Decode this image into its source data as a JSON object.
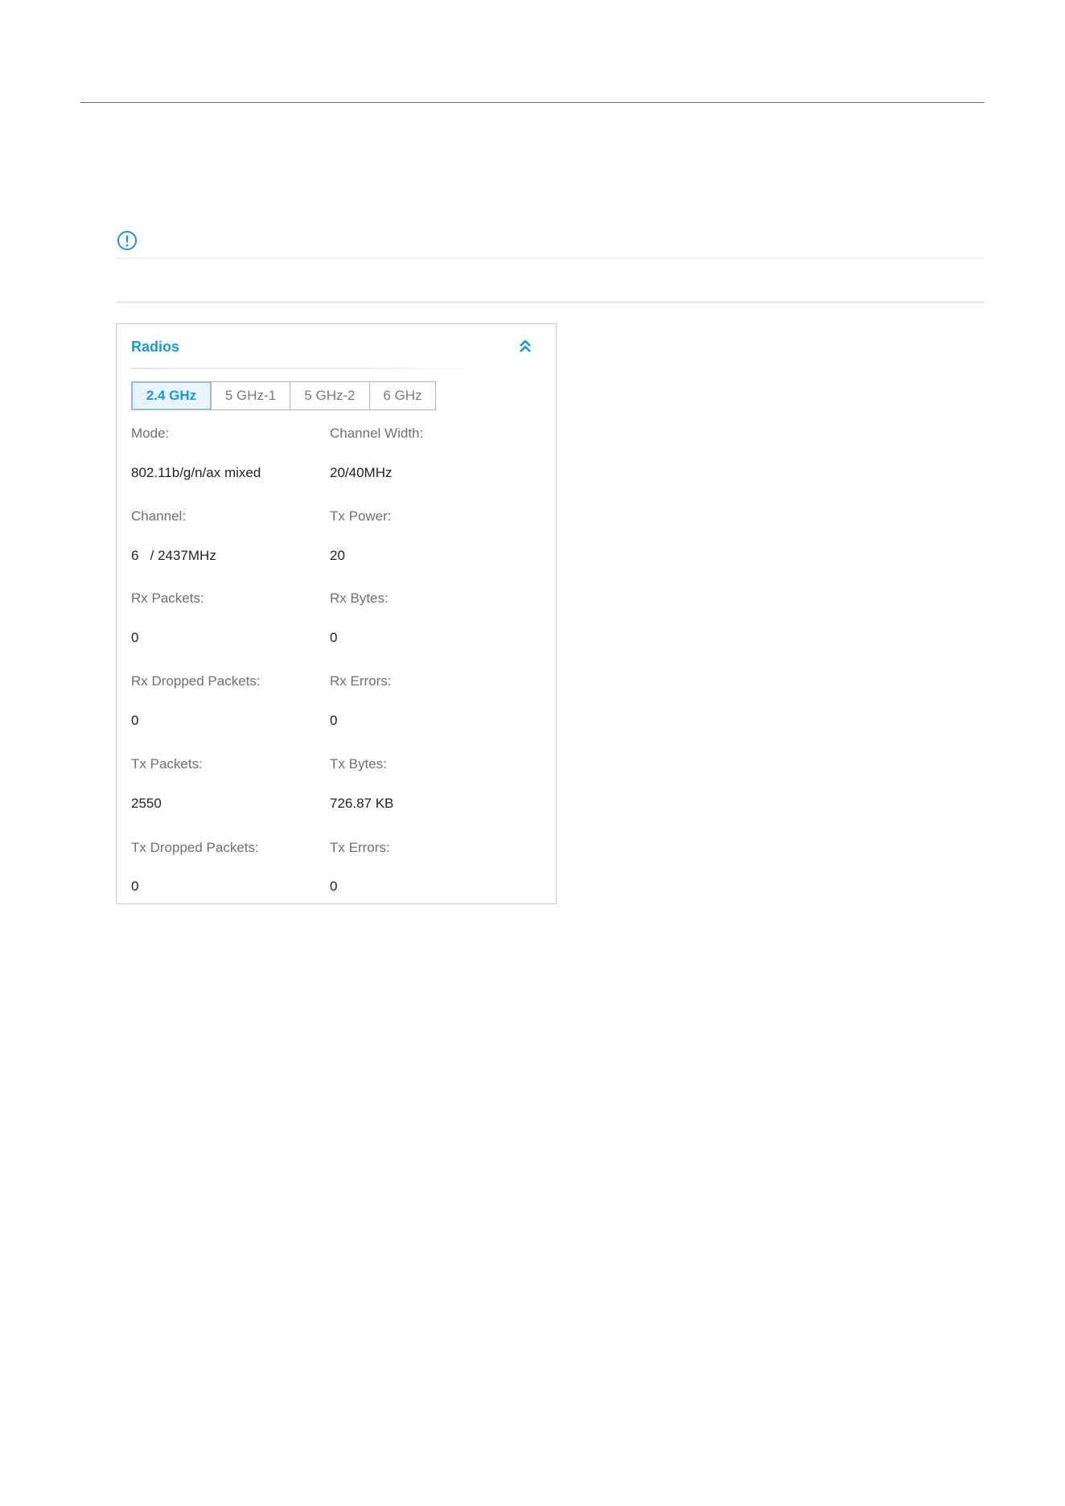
{
  "card": {
    "title": "Radios",
    "tabs": [
      {
        "label": "2.4 GHz",
        "active": true
      },
      {
        "label": "5 GHz-1",
        "active": false
      },
      {
        "label": "5 GHz-2",
        "active": false
      },
      {
        "label": "6 GHz",
        "active": false
      }
    ],
    "fields": [
      {
        "label": "Mode:",
        "value": "802.11b/g/n/ax mixed"
      },
      {
        "label": "Channel Width:",
        "value": "20/40MHz"
      },
      {
        "label": "Channel:",
        "value": "6   / 2437MHz"
      },
      {
        "label": "Tx Power:",
        "value": "20"
      },
      {
        "label": "Rx Packets:",
        "value": "0"
      },
      {
        "label": "Rx Bytes:",
        "value": "0"
      },
      {
        "label": "Rx Dropped Packets:",
        "value": "0"
      },
      {
        "label": "Rx Errors:",
        "value": "0"
      },
      {
        "label": "Tx Packets:",
        "value": "2550"
      },
      {
        "label": "Tx Bytes:",
        "value": "726.87 KB"
      },
      {
        "label": "Tx Dropped Packets:",
        "value": "0"
      },
      {
        "label": "Tx Errors:",
        "value": "0"
      }
    ]
  },
  "icons": {
    "notice": "exclamation-circle-icon",
    "collapse": "double-chevron-up-icon"
  },
  "colors": {
    "accent": "#1b98d4",
    "active_tab_bg": "#e8f3fb"
  }
}
